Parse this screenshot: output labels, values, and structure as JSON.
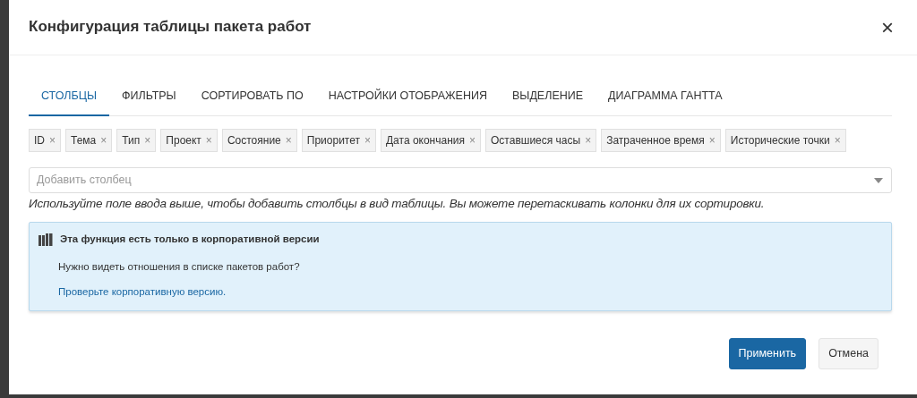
{
  "dialog": {
    "title": "Конфигурация таблицы пакета работ",
    "close": "×"
  },
  "tabs": [
    {
      "label": "СТОЛБЦЫ",
      "selected": true
    },
    {
      "label": "ФИЛЬТРЫ",
      "selected": false
    },
    {
      "label": "СОРТИРОВАТЬ ПО",
      "selected": false
    },
    {
      "label": "НАСТРОЙКИ ОТОБРАЖЕНИЯ",
      "selected": false
    },
    {
      "label": "ВЫДЕЛЕНИЕ",
      "selected": false
    },
    {
      "label": "ДИАГРАММА ГАНТТА",
      "selected": false
    }
  ],
  "columns": [
    {
      "label": "ID",
      "remove": "×"
    },
    {
      "label": "Тема",
      "remove": "×"
    },
    {
      "label": "Тип",
      "remove": "×"
    },
    {
      "label": "Проект",
      "remove": "×"
    },
    {
      "label": "Состояние",
      "remove": "×"
    },
    {
      "label": "Приоритет",
      "remove": "×"
    },
    {
      "label": "Дата окончания",
      "remove": "×"
    },
    {
      "label": "Оставшиеся часы",
      "remove": "×"
    },
    {
      "label": "Затраченное время",
      "remove": "×"
    },
    {
      "label": "Исторические точки",
      "remove": "×"
    }
  ],
  "add_column": {
    "placeholder": "Добавить столбец"
  },
  "help_text": "Используйте поле ввода выше, чтобы добавить столбцы в вид таблицы. Вы можете перетаскивать колонки для их сортировки.",
  "notice": {
    "title": "Эта функция есть только в корпоративной версии",
    "text": "Нужно видеть отношения в списке пакетов работ?",
    "link": "Проверьте корпоративную версию."
  },
  "buttons": [
    {
      "label": "Применить",
      "kind": "primary"
    },
    {
      "label": "Отмена",
      "kind": "secondary"
    }
  ]
}
